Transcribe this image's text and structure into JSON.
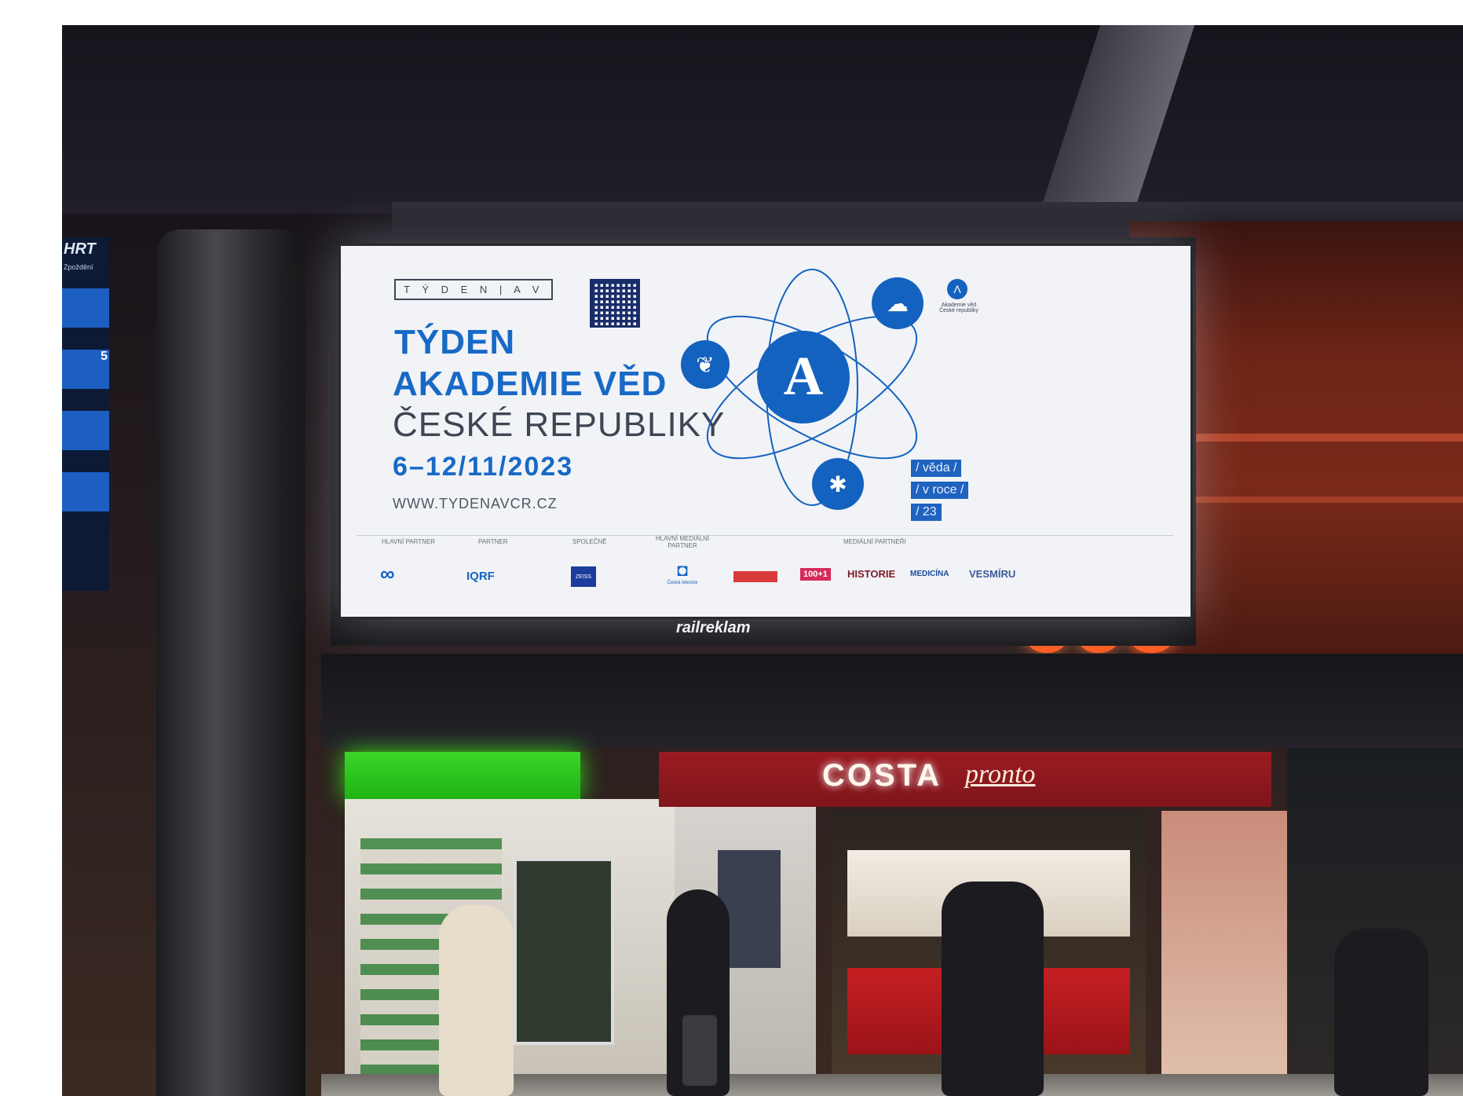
{
  "billboard": {
    "logo_text": "T Ý D E N | A V",
    "title_line1": "TÝDEN",
    "title_line2": "AKADEMIE VĚD",
    "title_line3": "ČESKÉ REPUBLIKY",
    "dates": "6–12/11/2023",
    "url": "WWW.TYDENAVCR.CZ",
    "academy_name_line1": "Akademie věd",
    "academy_name_line2": "České republiky",
    "tags": [
      "/ věda /",
      "/ v roce /",
      "/ 23"
    ],
    "center_letter": "A",
    "partner_headings": [
      "HLAVNÍ PARTNER",
      "PARTNER",
      "SPOLEČNĚ",
      "HLAVNÍ MEDIÁLNÍ PARTNER",
      "MEDIÁLNÍ PARTNEŘI"
    ],
    "partner_logos": [
      "IQRF",
      "ZEISS",
      "Česká televize",
      "100+1",
      "HISTORIE",
      "MEDICÍNA",
      "VESMÍRU"
    ]
  },
  "screen_owner": "railreklam",
  "store_signs": {
    "eco": "eco",
    "costa": "COSTA",
    "pronto": "pronto"
  },
  "departure_board": {
    "header": "HRT",
    "line1": "Zpoždění",
    "number": "5"
  },
  "colors": {
    "brand_blue": "#1869c6",
    "costa_red": "#9b1b22",
    "eco_orange": "#ff5a1f",
    "green_sign": "#3ad628"
  }
}
